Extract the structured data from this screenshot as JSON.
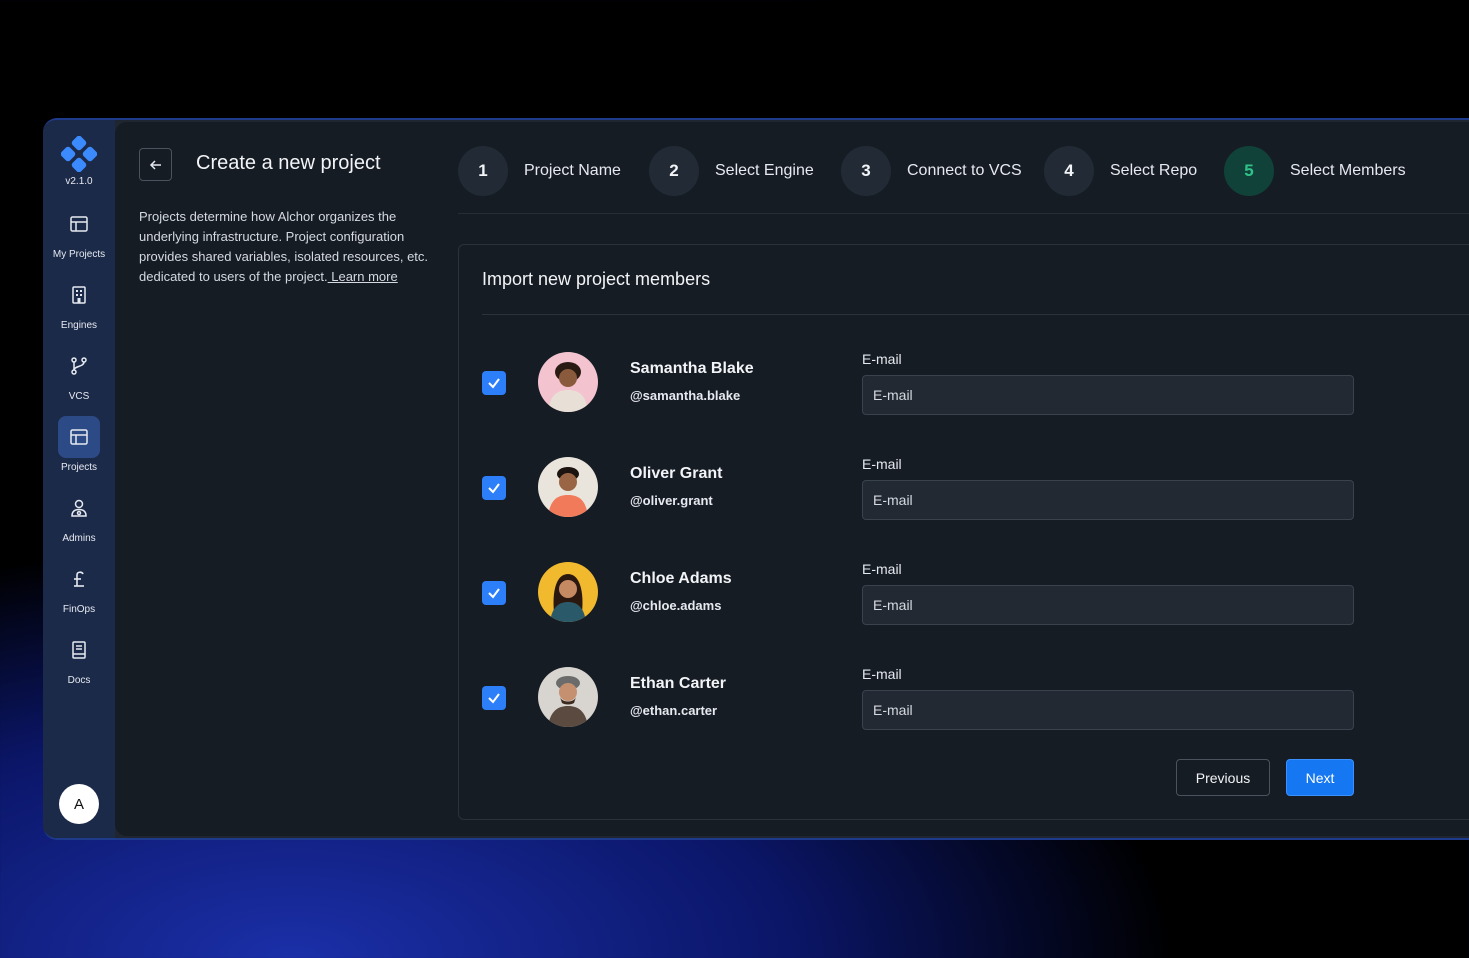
{
  "app": {
    "version": "v2.1.0",
    "avatar_initial": "A"
  },
  "sidebar": {
    "items": [
      {
        "label": "My Projects",
        "icon": "layout-icon"
      },
      {
        "label": "Engines",
        "icon": "building-icon"
      },
      {
        "label": "VCS",
        "icon": "git-branch-icon"
      },
      {
        "label": "Projects",
        "icon": "layout-icon",
        "active": true
      },
      {
        "label": "Admins",
        "icon": "admin-user-icon"
      },
      {
        "label": "FinOps",
        "icon": "pound-icon"
      },
      {
        "label": "Docs",
        "icon": "book-icon"
      }
    ]
  },
  "page": {
    "title": "Create a new project",
    "description": "Projects determine how Alchor organizes the underlying infrastructure.  Project configuration provides shared variables, isolated resources,  etc. dedicated to users of the project.",
    "learn_more": " Learn more"
  },
  "steps": [
    {
      "num": "1",
      "label": "Project Name"
    },
    {
      "num": "2",
      "label": "Select Engine"
    },
    {
      "num": "3",
      "label": "Connect to VCS"
    },
    {
      "num": "4",
      "label": "Select Repo"
    },
    {
      "num": "5",
      "label": "Select Members",
      "active": true
    }
  ],
  "card": {
    "title": "Import new project members",
    "email_label": "E-mail",
    "email_placeholder": "E-mail",
    "members": [
      {
        "name": "Samantha Blake",
        "handle": "@samantha.blake",
        "checked": true,
        "avatar_bg": "#f3c3cf"
      },
      {
        "name": "Oliver Grant",
        "handle": "@oliver.grant",
        "checked": true,
        "avatar_bg": "#e9e4dc"
      },
      {
        "name": "Chloe Adams",
        "handle": "@chloe.adams",
        "checked": true,
        "avatar_bg": "#f0b92e"
      },
      {
        "name": "Ethan Carter",
        "handle": "@ethan.carter",
        "checked": true,
        "avatar_bg": "#d8d4cf"
      }
    ],
    "previous_label": "Previous",
    "next_label": "Next"
  },
  "colors": {
    "accent": "#1677f2",
    "step_active": "#2fc38a",
    "sidebar_bg": "#1c2a4a"
  }
}
